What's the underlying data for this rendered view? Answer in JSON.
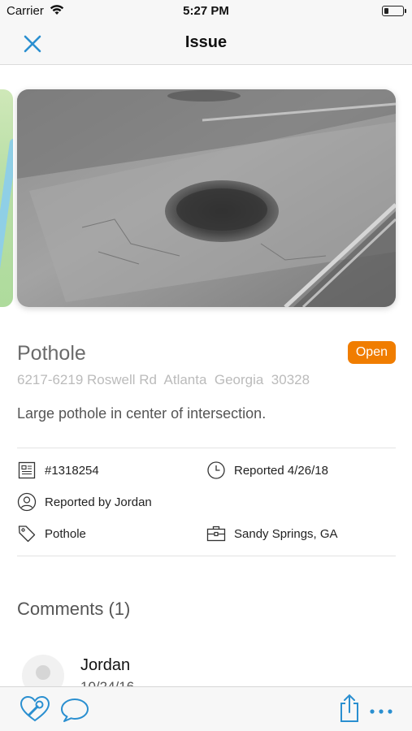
{
  "status_bar": {
    "carrier": "Carrier",
    "time": "5:27 PM",
    "battery_level": 0.25
  },
  "nav": {
    "title": "Issue",
    "close_icon": "close-icon"
  },
  "issue": {
    "title": "Pothole",
    "status": "Open",
    "address": "6217-6219 Roswell Rd  Atlanta  Georgia  30328",
    "description": "Large pothole in center of intersection.",
    "id": "#1318254",
    "reported_date": "Reported 4/26/18",
    "reported_by": "Reported by Jordan",
    "category": "Pothole",
    "jurisdiction": "Sandy Springs, GA"
  },
  "comments": {
    "header": "Comments (1)",
    "items": [
      {
        "author": "Jordan",
        "date": "10/24/16"
      }
    ]
  },
  "toolbar": {
    "left_icons": [
      "heart-wrench-icon",
      "comment-icon"
    ],
    "right_icons": [
      "share-icon",
      "more-icon"
    ]
  },
  "colors": {
    "accent": "#2a8fd0",
    "status_open": "#f07d00",
    "muted_text": "#6b6b6b"
  }
}
